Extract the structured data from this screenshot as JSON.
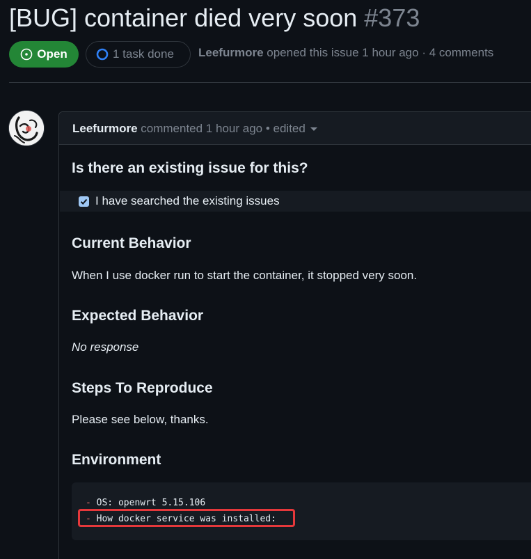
{
  "issue": {
    "title": "[BUG] container died very soon",
    "number": "#373",
    "state_label": "Open",
    "task_label": "1 task done",
    "author": "Leefurmore",
    "meta_text": "opened this issue 1 hour ago · 4 comments"
  },
  "comment": {
    "author": "Leefurmore",
    "header_text": "commented 1 hour ago",
    "edited_text": "• edited"
  },
  "sections": {
    "existing_issue": {
      "heading": "Is there an existing issue for this?",
      "checkbox_label": "I have searched the existing issues",
      "checked": true
    },
    "current_behavior": {
      "heading": "Current Behavior",
      "text": "When I use docker run to start the container, it stopped very soon."
    },
    "expected_behavior": {
      "heading": "Expected Behavior",
      "text": "No response"
    },
    "steps": {
      "heading": "Steps To Reproduce",
      "text": "Please see below, thanks."
    },
    "environment": {
      "heading": "Environment",
      "lines": [
        {
          "dash": "-",
          "text": " OS: openwrt 5.15.106"
        },
        {
          "dash": "-",
          "text": " How docker service was installed:"
        }
      ]
    }
  },
  "colors": {
    "open_green": "#238636",
    "highlight_red": "#e5383b",
    "background": "#0d1117"
  }
}
